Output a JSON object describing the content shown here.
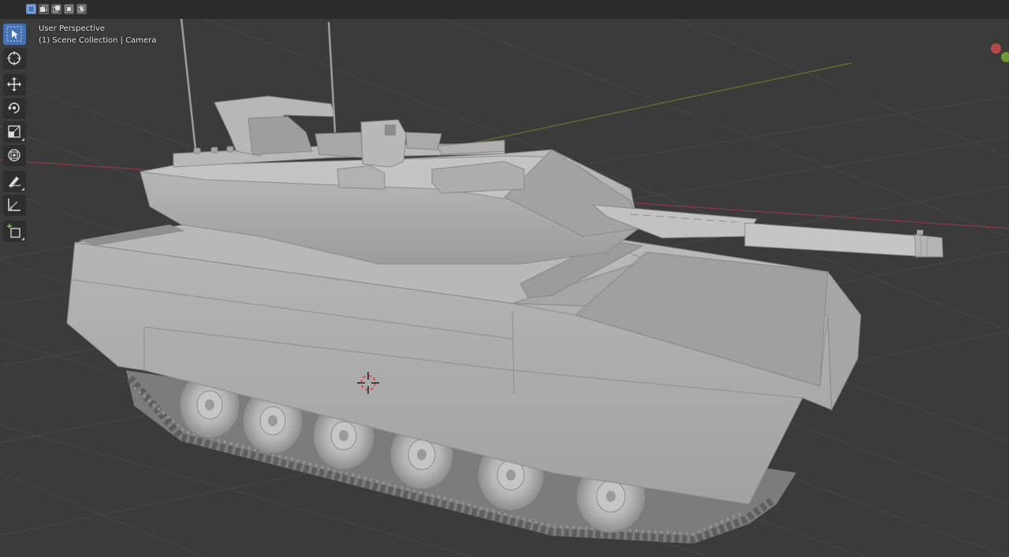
{
  "viewport": {
    "perspective_label": "User Perspective",
    "collection_label": "(1) Scene Collection | Camera"
  },
  "header": {
    "select_modes": [
      "select-box-icon",
      "select-extend-icon",
      "select-subtract-icon",
      "select-invert-icon",
      "select-intersect-icon"
    ]
  },
  "toolbar": {
    "tools": [
      {
        "name": "tool-select-box",
        "icon": "cursor-icon",
        "active": true
      },
      {
        "name": "tool-cursor",
        "icon": "3d-cursor-icon",
        "active": false
      },
      {
        "name": "tool-move",
        "icon": "move-icon",
        "active": false
      },
      {
        "name": "tool-rotate",
        "icon": "rotate-icon",
        "active": false
      },
      {
        "name": "tool-scale",
        "icon": "scale-icon",
        "active": false
      },
      {
        "name": "tool-transform",
        "icon": "transform-icon",
        "active": false
      },
      {
        "name": "tool-annotate",
        "icon": "annotate-icon",
        "active": false
      },
      {
        "name": "tool-measure",
        "icon": "measure-icon",
        "active": false
      },
      {
        "name": "tool-add-cube",
        "icon": "add-cube-icon",
        "active": false
      }
    ]
  },
  "colors": {
    "viewport_bg": "#3b3b3b",
    "grid": "#4a4a4a",
    "x_axis": "#9a3a44",
    "y_axis": "#6a8a32",
    "accent": "#4772b3",
    "model": "#a8a8a8",
    "gizmo_x": "#d9534f",
    "gizmo_y": "#7fb23a"
  }
}
